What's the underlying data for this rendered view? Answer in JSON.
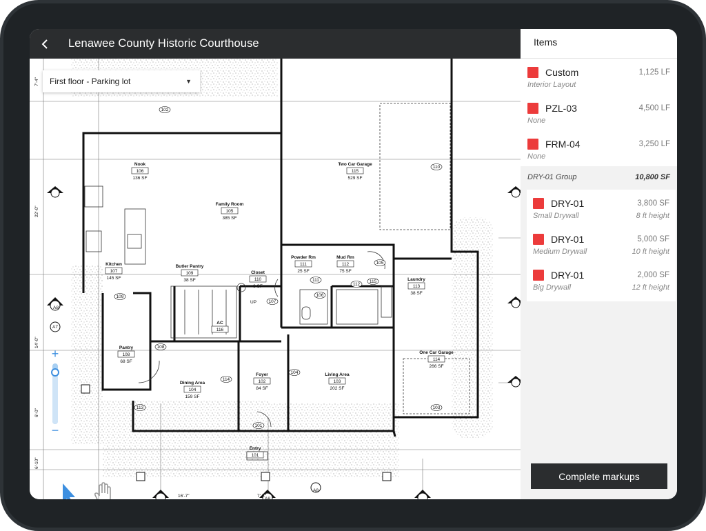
{
  "header": {
    "title": "Lenawee County Historic Courthouse"
  },
  "floor_selector": {
    "value": "First floor - Parking lot"
  },
  "zoom": {
    "level": 0.85
  },
  "panel": {
    "title": "Items",
    "items": [
      {
        "name": "Custom",
        "quantity": "1,125 LF",
        "subtitle": "Interior Layout",
        "detail": "",
        "color": "#ec3b3b"
      },
      {
        "name": "PZL-03",
        "quantity": "4,500 LF",
        "subtitle": "None",
        "detail": "",
        "color": "#ec3b3b"
      },
      {
        "name": "FRM-04",
        "quantity": "3,250 LF",
        "subtitle": "None",
        "detail": "",
        "color": "#ec3b3b"
      }
    ],
    "group": {
      "name": "DRY-01 Group",
      "total": "10,800 SF",
      "items": [
        {
          "name": "DRY-01",
          "quantity": "3,800 SF",
          "subtitle": "Small Drywall",
          "detail": "8 ft height",
          "color": "#ec3b3b"
        },
        {
          "name": "DRY-01",
          "quantity": "5,000 SF",
          "subtitle": "Medium Drywall",
          "detail": "10 ft height",
          "color": "#ec3b3b"
        },
        {
          "name": "DRY-01",
          "quantity": "2,000 SF",
          "subtitle": "Big Drywall",
          "detail": "12 ft height",
          "color": "#ec3b3b"
        }
      ]
    },
    "complete_label": "Complete markups"
  },
  "rooms": [
    {
      "name": "Nook",
      "number": "106",
      "area": "136 SF"
    },
    {
      "name": "Family Room",
      "number": "105",
      "area": "385 SF"
    },
    {
      "name": "Two Car Garage",
      "number": "115",
      "area": "529 SF"
    },
    {
      "name": "Kitchen",
      "number": "107",
      "area": "145 SF"
    },
    {
      "name": "Butler Pantry",
      "number": "109",
      "area": "38 SF"
    },
    {
      "name": "Closet",
      "number": "110",
      "area": "8 SF"
    },
    {
      "name": "Powder Rm",
      "number": "111",
      "area": "25 SF"
    },
    {
      "name": "Mud Rm",
      "number": "112",
      "area": "75 SF"
    },
    {
      "name": "Laundry",
      "number": "113",
      "area": "38 SF"
    },
    {
      "name": "AC",
      "number": "116",
      "area": ""
    },
    {
      "name": "Pantry",
      "number": "108",
      "area": "68 SF"
    },
    {
      "name": "Dining Area",
      "number": "104",
      "area": "159 SF"
    },
    {
      "name": "Foyer",
      "number": "102",
      "area": "84 SF"
    },
    {
      "name": "Living Area",
      "number": "103",
      "area": "202 SF"
    },
    {
      "name": "One Car Garage",
      "number": "114",
      "area": "266 SF"
    },
    {
      "name": "Entry",
      "number": "101",
      "area": ""
    }
  ],
  "door_tags": [
    "102",
    "111",
    "106",
    "105",
    "109",
    "108",
    "110",
    "107",
    "114",
    "115",
    "113",
    "104",
    "112",
    "103",
    "101"
  ],
  "dimension_labels": [
    "7'-4\"",
    "22'-0\"",
    "14'-0\"",
    "6'-0\"",
    "6'-10\"",
    "16'-7\"",
    "7'-5\""
  ],
  "section_markers": [
    "A8",
    "A7",
    "A8",
    "A8",
    "A8"
  ],
  "stair_label": "UP"
}
